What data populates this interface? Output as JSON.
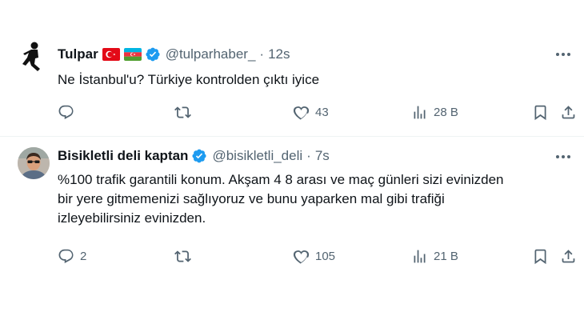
{
  "tweets": [
    {
      "name": "Tulpar",
      "flags": [
        "turkey-flag",
        "azerbaijan-flag"
      ],
      "handle": "@tulparhaber_",
      "separator": "·",
      "time": "12s",
      "lines": [
        "Ne İstanbul'u? Türkiye kontrolden çıktı iyice"
      ],
      "replies": "",
      "retweets": "",
      "likes": "43",
      "views": "28 B"
    },
    {
      "name": "Bisikletli deli kaptan",
      "flags": [],
      "handle": "@bisikletli_deli",
      "separator": "·",
      "time": "7s",
      "lines": [
        "%100 trafik garantili konum. Akşam 4 8 arası ve maç günleri sizi evinizden",
        "bir yere gitmemenizi sağlıyoruz ve bunu yaparken mal gibi trafiği",
        "izleyebilirsiniz evinizden."
      ],
      "replies": "2",
      "retweets": "",
      "likes": "105",
      "views": "21 B"
    }
  ],
  "colors": {
    "verified": "#1d9bf0",
    "text": "#0f1419",
    "secondary": "#536471",
    "divider": "#eff3f4"
  },
  "icons": {
    "reply": "reply-icon",
    "retweet": "retweet-icon",
    "like": "heart-icon",
    "views": "views-icon",
    "bookmark": "bookmark-icon",
    "share": "share-icon",
    "more": "more-icon",
    "verified": "verified-badge-icon"
  }
}
